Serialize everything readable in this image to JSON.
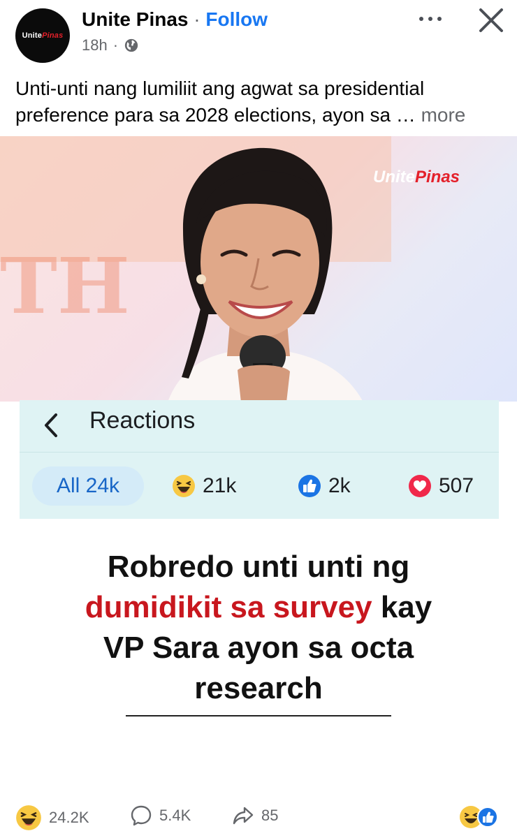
{
  "post": {
    "page_name": "Unite Pinas",
    "separator": "·",
    "follow_label": "Follow",
    "time": "18h",
    "time_separator": "·",
    "avatar_text_white": "Unite",
    "avatar_text_red": "Pinas",
    "caption": "Unti-unti nang lumiliit ang agwat sa presidential preference para sa 2028 elections, ayon sa …",
    "see_more": "more"
  },
  "image": {
    "watermark_white": "Unite",
    "watermark_red": "Pinas",
    "background_letters": "TH",
    "reactions_title": "Reactions",
    "tabs": [
      {
        "label": "All 24k",
        "icon": "none"
      },
      {
        "label": "21k",
        "icon": "haha-icon"
      },
      {
        "label": "2k",
        "icon": "like-icon"
      },
      {
        "label": "507",
        "icon": "love-icon"
      }
    ],
    "headline_line1": "Robredo unti unti ng",
    "headline_accent": "dumidikit sa survey",
    "headline_after_accent": " kay",
    "headline_line3": "VP Sara ayon sa octa",
    "headline_line4": "research"
  },
  "footer": {
    "reactions_count": "24.2K",
    "comments_count": "5.4K",
    "shares_count": "85"
  },
  "colors": {
    "follow": "#1877f2",
    "headline_accent": "#c8171e",
    "panel": "#dff3f4"
  }
}
